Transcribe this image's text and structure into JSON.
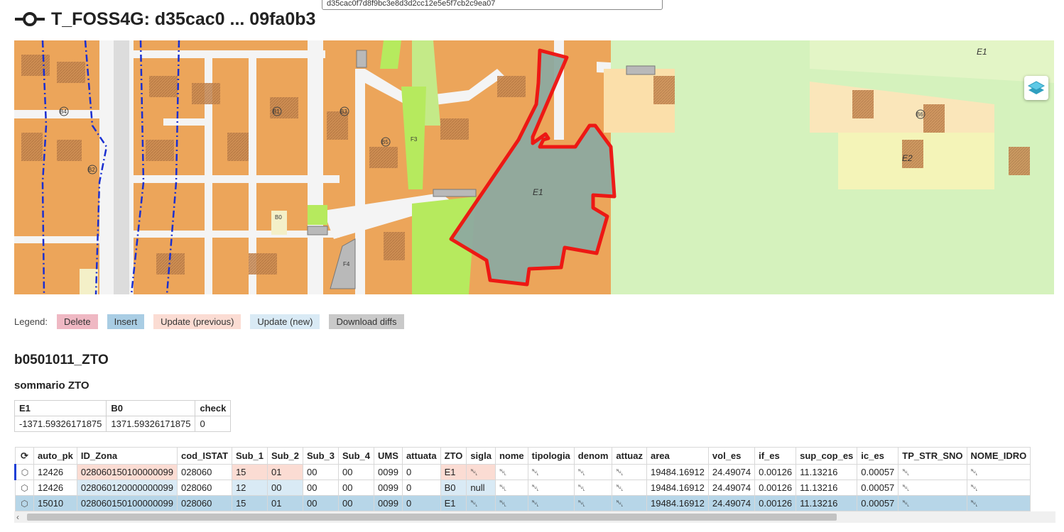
{
  "tooltip": "d35cac0f7d8f9bc3e8d3d2cc12e5e5f7cb2c9ea07",
  "title": "T_FOSS4G: d35cac0 ... 09fa0b3",
  "map": {
    "zone_labels": [
      "E1",
      "E2",
      "E1",
      "B1",
      "B2",
      "B3",
      "B4",
      "B5",
      "B6",
      "B0",
      "F3",
      "F4"
    ],
    "layers_icon": "layers-icon"
  },
  "legend": {
    "label": "Legend:",
    "delete": "Delete",
    "insert": "Insert",
    "update_prev": "Update (previous)",
    "update_new": "Update (new)",
    "download": "Download diffs"
  },
  "layer_title": "b0501011_ZTO",
  "summary_title": "sommario ZTO",
  "summary": {
    "headers": [
      "E1",
      "B0",
      "check"
    ],
    "values": [
      "-1371.59326171875",
      "1371.59326171875",
      "0"
    ]
  },
  "grid": {
    "headers": [
      "auto_pk",
      "ID_Zona",
      "cod_ISTAT",
      "Sub_1",
      "Sub_2",
      "Sub_3",
      "Sub_4",
      "UMS",
      "attuata",
      "ZTO",
      "sigla",
      "nome",
      "tipologia",
      "denom",
      "attuaz",
      "area",
      "vol_es",
      "if_es",
      "sup_cop_es",
      "ic_es",
      "TP_STR_SNO",
      "NOME_IDRO"
    ],
    "rows": [
      [
        "12426",
        "028060150100000099",
        "028060",
        "15",
        "01",
        "00",
        "00",
        "0099",
        "0",
        "E1",
        "␀",
        "␀",
        "␀",
        "␀",
        "␀",
        "19484.16912",
        "24.49074",
        "0.00126",
        "11.13216",
        "0.00057",
        "␀",
        "␀"
      ],
      [
        "12426",
        "028060120000000099",
        "028060",
        "12",
        "00",
        "00",
        "00",
        "0099",
        "0",
        "B0",
        "null",
        "␀",
        "␀",
        "␀",
        "␀",
        "19484.16912",
        "24.49074",
        "0.00126",
        "11.13216",
        "0.00057",
        "␀",
        "␀"
      ],
      [
        "15010",
        "028060150100000099",
        "028060",
        "15",
        "01",
        "00",
        "00",
        "0099",
        "0",
        "E1",
        "␀",
        "␀",
        "␀",
        "␀",
        "␀",
        "19484.16912",
        "24.49074",
        "0.00126",
        "11.13216",
        "0.00057",
        "␀",
        "␀"
      ]
    ]
  }
}
